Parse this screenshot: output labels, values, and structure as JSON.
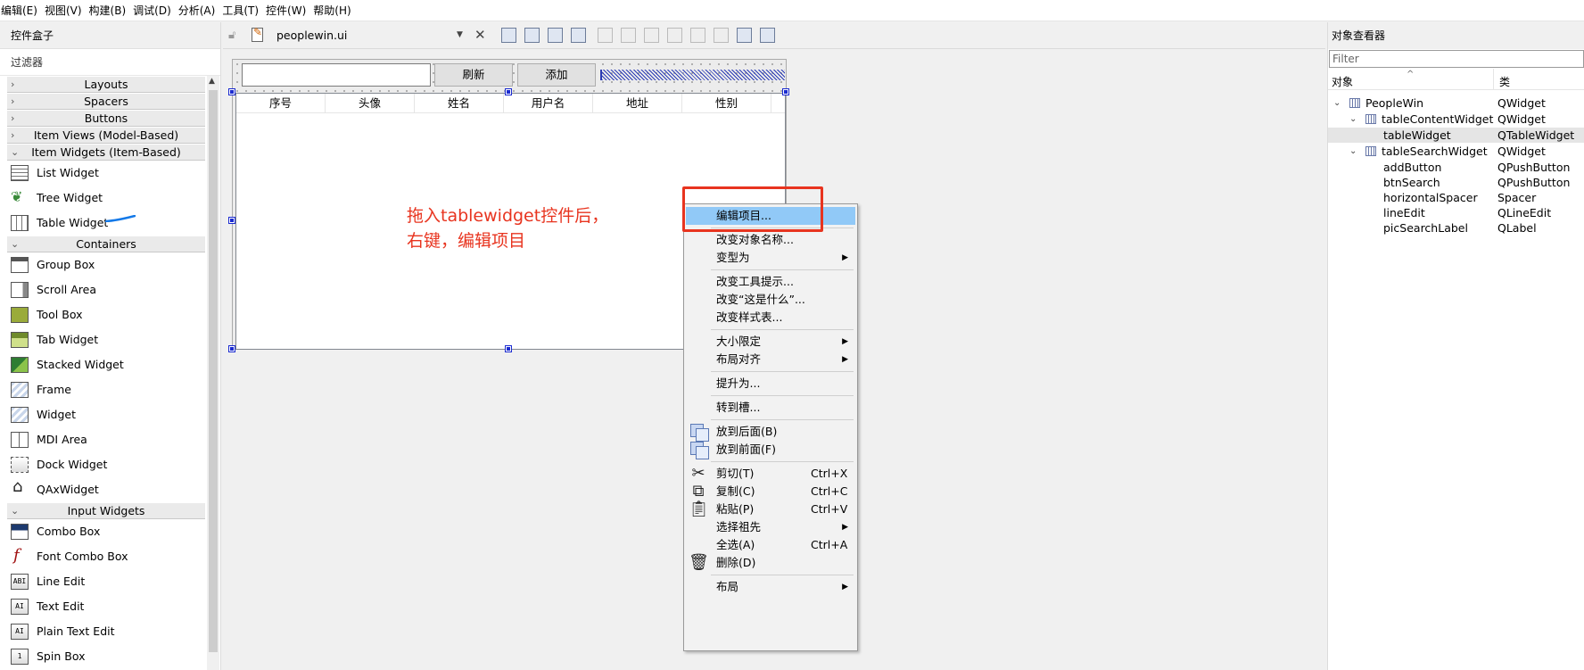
{
  "menubar": [
    "编辑(E)",
    "视图(V)",
    "构建(B)",
    "调试(D)",
    "分析(A)",
    "工具(T)",
    "控件(W)",
    "帮助(H)"
  ],
  "widgetbox": {
    "title": "控件盒子",
    "filter_placeholder": "过滤器",
    "entries": [
      {
        "kind": "cat",
        "label": "Layouts",
        "open": false
      },
      {
        "kind": "cat",
        "label": "Spacers",
        "open": false
      },
      {
        "kind": "cat",
        "label": "Buttons",
        "open": false
      },
      {
        "kind": "cat",
        "label": "Item Views (Model-Based)",
        "open": false
      },
      {
        "kind": "cat",
        "label": "Item Widgets (Item-Based)",
        "open": true
      },
      {
        "kind": "item",
        "label": "List Widget",
        "icon": "list-widget-icon",
        "cls": "list"
      },
      {
        "kind": "item",
        "label": "Tree Widget",
        "icon": "tree-widget-icon",
        "cls": "tree"
      },
      {
        "kind": "item",
        "label": "Table Widget",
        "icon": "table-widget-icon",
        "cls": "table"
      },
      {
        "kind": "cat",
        "label": "Containers",
        "open": true
      },
      {
        "kind": "item",
        "label": "Group Box",
        "icon": "group-box-icon",
        "cls": "group"
      },
      {
        "kind": "item",
        "label": "Scroll Area",
        "icon": "scroll-area-icon",
        "cls": "scroll"
      },
      {
        "kind": "item",
        "label": "Tool Box",
        "icon": "tool-box-icon",
        "cls": "tool"
      },
      {
        "kind": "item",
        "label": "Tab Widget",
        "icon": "tab-widget-icon",
        "cls": "tab"
      },
      {
        "kind": "item",
        "label": "Stacked Widget",
        "icon": "stacked-widget-icon",
        "cls": "stacked"
      },
      {
        "kind": "item",
        "label": "Frame",
        "icon": "frame-icon",
        "cls": "frame"
      },
      {
        "kind": "item",
        "label": "Widget",
        "icon": "widget-icon",
        "cls": "widget"
      },
      {
        "kind": "item",
        "label": "MDI Area",
        "icon": "mdi-area-icon",
        "cls": "mdi"
      },
      {
        "kind": "item",
        "label": "Dock Widget",
        "icon": "dock-widget-icon",
        "cls": "dock"
      },
      {
        "kind": "item",
        "label": "QAxWidget",
        "icon": "qax-widget-icon",
        "cls": "qax"
      },
      {
        "kind": "cat",
        "label": "Input Widgets",
        "open": true
      },
      {
        "kind": "item",
        "label": "Combo Box",
        "icon": "combo-box-icon",
        "cls": "combo"
      },
      {
        "kind": "item",
        "label": "Font Combo Box",
        "icon": "font-combo-box-icon",
        "cls": "font"
      },
      {
        "kind": "item",
        "label": "Line Edit",
        "icon": "line-edit-icon",
        "cls": "line",
        "glyph": "ABI"
      },
      {
        "kind": "item",
        "label": "Text Edit",
        "icon": "text-edit-icon",
        "cls": "text",
        "glyph": "AI"
      },
      {
        "kind": "item",
        "label": "Plain Text Edit",
        "icon": "plain-text-edit-icon",
        "cls": "plain",
        "glyph": "AI"
      },
      {
        "kind": "item",
        "label": "Spin Box",
        "icon": "spin-box-icon",
        "cls": "spin",
        "glyph": "1"
      }
    ]
  },
  "editor": {
    "file_name": "peoplewin.ui",
    "form": {
      "search_button": "刷新",
      "add_button": "添加",
      "table_headers": [
        "序号",
        "头像",
        "姓名",
        "用户名",
        "地址",
        "性别"
      ]
    },
    "annotation_lines": [
      "拖入tablewidget控件后，",
      "右键，编辑项目"
    ],
    "annotation_color": "#e8341f"
  },
  "context_menu": {
    "items": [
      {
        "label": "编辑项目...",
        "highlighted": true
      },
      {
        "sep": true
      },
      {
        "label": "改变对象名称..."
      },
      {
        "label": "变型为",
        "submenu": true
      },
      {
        "sep": true
      },
      {
        "label": "改变工具提示..."
      },
      {
        "label": "改变“这是什么”..."
      },
      {
        "label": "改变样式表..."
      },
      {
        "sep": true
      },
      {
        "label": "大小限定",
        "submenu": true
      },
      {
        "label": "布局对齐",
        "submenu": true
      },
      {
        "sep": true
      },
      {
        "label": "提升为..."
      },
      {
        "sep": true
      },
      {
        "label": "转到槽..."
      },
      {
        "sep": true
      },
      {
        "label": "放到后面(B)",
        "icon": "send-to-back-icon"
      },
      {
        "label": "放到前面(F)",
        "icon": "bring-to-front-icon"
      },
      {
        "sep": true
      },
      {
        "label": "剪切(T)",
        "shortcut": "Ctrl+X",
        "icon": "scissors-icon"
      },
      {
        "label": "复制(C)",
        "shortcut": "Ctrl+C",
        "icon": "copy-icon"
      },
      {
        "label": "粘贴(P)",
        "shortcut": "Ctrl+V",
        "icon": "paste-icon"
      },
      {
        "label": "选择祖先",
        "submenu": true
      },
      {
        "label": "全选(A)",
        "shortcut": "Ctrl+A"
      },
      {
        "label": "删除(D)",
        "icon": "trash-icon"
      },
      {
        "sep": true
      },
      {
        "label": "布局",
        "submenu": true
      }
    ]
  },
  "inspector": {
    "title": "对象查看器",
    "filter_placeholder": "Filter",
    "col_object": "对象",
    "col_class": "类",
    "rows": [
      {
        "name": "PeopleWin",
        "cls": "QWidget",
        "depth": 0,
        "expanded": true,
        "icon": true
      },
      {
        "name": "tableContentWidget",
        "cls": "QWidget",
        "depth": 1,
        "expanded": true,
        "icon": true
      },
      {
        "name": "tableWidget",
        "cls": "QTableWidget",
        "depth": 2,
        "selected": true
      },
      {
        "name": "tableSearchWidget",
        "cls": "QWidget",
        "depth": 1,
        "expanded": true,
        "icon": true
      },
      {
        "name": "addButton",
        "cls": "QPushButton",
        "depth": 2
      },
      {
        "name": "btnSearch",
        "cls": "QPushButton",
        "depth": 2
      },
      {
        "name": "horizontalSpacer",
        "cls": "Spacer",
        "depth": 2
      },
      {
        "name": "lineEdit",
        "cls": "QLineEdit",
        "depth": 2
      },
      {
        "name": "picSearchLabel",
        "cls": "QLabel",
        "depth": 2
      }
    ]
  }
}
